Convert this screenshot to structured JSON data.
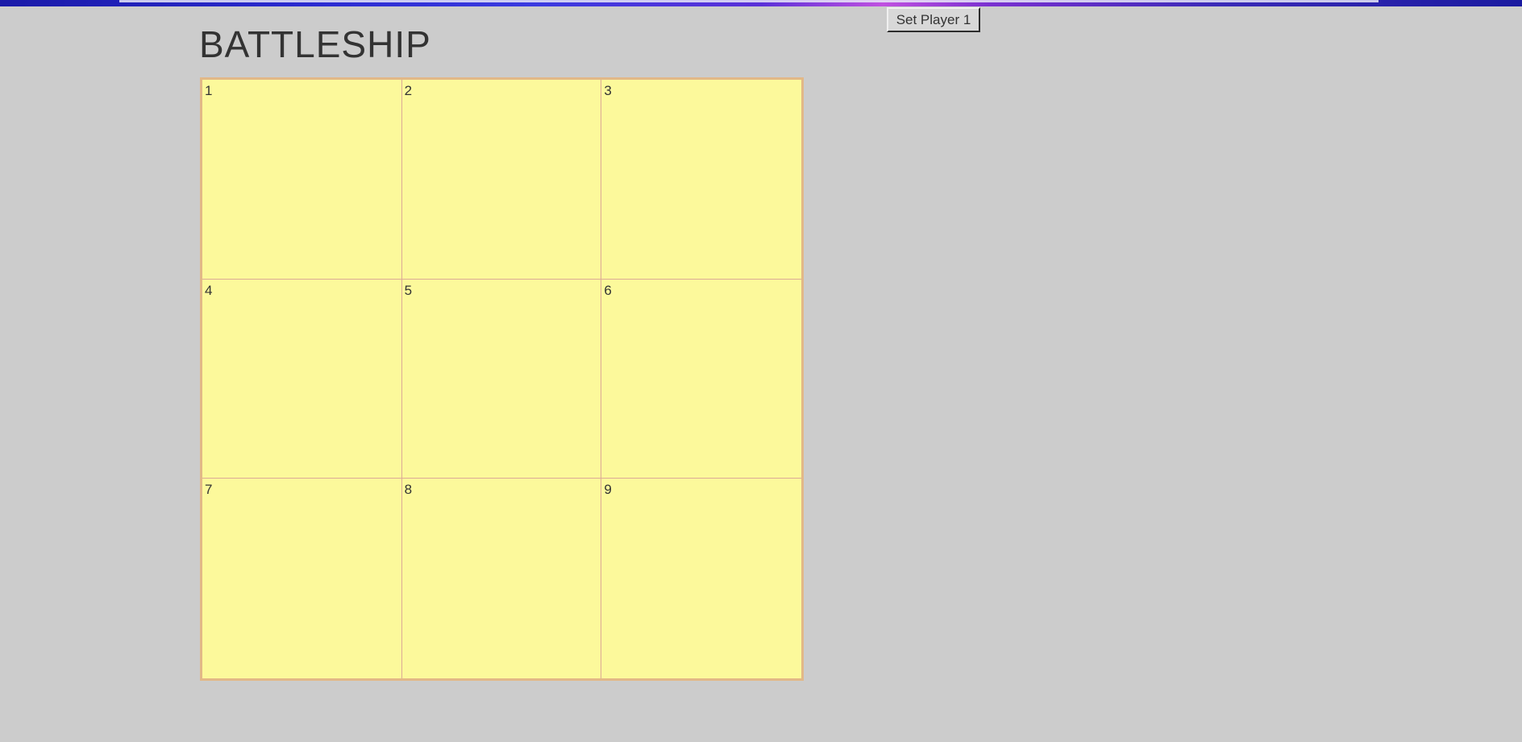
{
  "header": {
    "title": "BATTLESHIP",
    "set_player_label": "Set Player 1"
  },
  "board": {
    "cells": [
      {
        "label": "1"
      },
      {
        "label": "2"
      },
      {
        "label": "3"
      },
      {
        "label": "4"
      },
      {
        "label": "5"
      },
      {
        "label": "6"
      },
      {
        "label": "7"
      },
      {
        "label": "8"
      },
      {
        "label": "9"
      }
    ]
  },
  "colors": {
    "page_background": "#cccccc",
    "cell_background": "#fcf99b",
    "board_border": "#e2b887",
    "cell_divider": "#dcaa96",
    "text": "#333333"
  }
}
